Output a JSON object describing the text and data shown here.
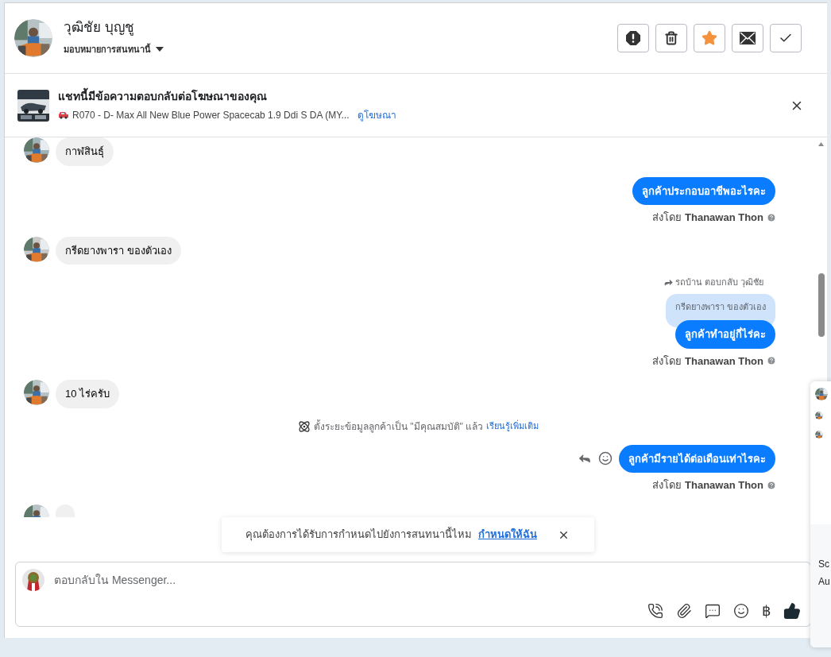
{
  "contact": {
    "name": "วุฒิชัย บุญชู",
    "assign_label": "มอบหมายการสนทนานี้"
  },
  "actions": [
    {
      "kind": "spam"
    },
    {
      "kind": "delete"
    },
    {
      "kind": "star",
      "on": true
    },
    {
      "kind": "mail"
    },
    {
      "kind": "done"
    }
  ],
  "ad_banner": {
    "title": "แชทนี้มีข้อความตอบกลับต่อโฆษณาของคุณ",
    "ad_name": "R070 - D- Max All New Blue Power Spacecab 1.9 Ddi S DA (MY...",
    "link": "ดูโฆษณา"
  },
  "messages": [
    {
      "kind": "incoming",
      "text": "กาฬสินธุ์"
    },
    {
      "kind": "outgoing",
      "text": "ลูกค้าประกอบอาชีพอะไรคะ",
      "sent_by": "ส่งโดย **Thanawan Thon**"
    },
    {
      "kind": "incoming",
      "text": "กรีดยางพารา ของตัวเอง"
    },
    {
      "kind": "outgoing",
      "reply_header": "รถบ้าน ตอบกลับ วุฒิชัย",
      "quoted": "กรีดยางพารา ของตัวเอง",
      "text": "ลูกค้าทำอยู่กี่ไร่คะ",
      "sent_by": "ส่งโดย **Thanawan Thon**"
    },
    {
      "kind": "incoming",
      "text": "10 ไร่ครับ"
    },
    {
      "kind": "notice",
      "text": "ตั้งระยะข้อมูลลูกค้าเป็น \"มีคุณสมบัติ\" แล้ว",
      "link": "เรียนรู้เพิ่มเติม"
    },
    {
      "kind": "outgoing",
      "hover_actions": true,
      "text": "ลูกค้ามีรายได้ต่อเดือนเท่าไรคะ",
      "sent_by": "ส่งโดย **Thanawan Thon**"
    },
    {
      "kind": "incoming"
    }
  ],
  "toast": {
    "text": "คุณต้องการได้รับการกำหนดไปยังการสนทนานี้ไหม",
    "link": "กำหนดให้ฉัน"
  },
  "composer": {
    "placeholder": "ตอบกลับใน Messenger...",
    "currency_symbol": "฿"
  },
  "side_panel": {
    "texts": [
      "Sc",
      "Au"
    ]
  }
}
